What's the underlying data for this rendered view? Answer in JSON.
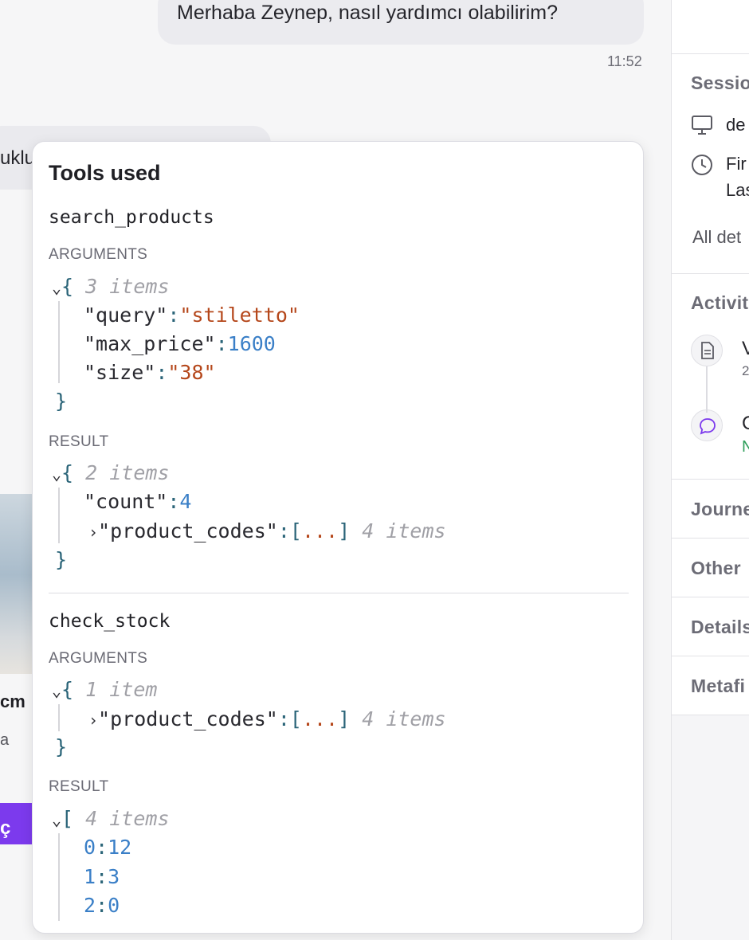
{
  "chat": {
    "outgoing_message": "Merhaba Zeynep, nasıl yardımcı olabilirim?",
    "outgoing_time": "11:52",
    "incoming_fragment": "uklu",
    "card_title_fragment": "cm",
    "card_sub_fragment": "a",
    "card_button_fragment": "ç"
  },
  "right_panel": {
    "session_title": "Sessio",
    "device_text": "de",
    "first_seen": "Fir",
    "last_seen": "Las",
    "all_details": "All det",
    "activity_title": "Activit",
    "activity_1_title": "V",
    "activity_1_sub": "2",
    "activity_2_title": "C",
    "activity_2_sub": "N",
    "journey_title": "Journe",
    "other_title": "Other",
    "details_title": "Details",
    "metafields_title": "Metafi",
    "icons": [
      "monitor-icon",
      "clock-icon",
      "document-icon",
      "chat-bubble-icon"
    ],
    "colors": {
      "activity_status": "#2e9e5b",
      "chat_icon": "#7c3aed"
    }
  },
  "tools_popover": {
    "title": "Tools used",
    "args_label": "ARGUMENTS",
    "result_label": "RESULT",
    "tool1": {
      "name": "search_products",
      "args_summary": "3 items",
      "args": [
        {
          "key": "\"query\"",
          "value": "\"stiletto\""
        },
        {
          "key": "\"max_price\"",
          "value": "1600"
        },
        {
          "key": "\"size\"",
          "value": "\"38\""
        }
      ],
      "result_summary": "2 items",
      "result": [
        {
          "key": "\"count\"",
          "value": "4"
        },
        {
          "key": "\"product_codes\"",
          "value": "[...]",
          "meta": "4 items"
        }
      ]
    },
    "tool2": {
      "name": "check_stock",
      "args_summary": "1 item",
      "args": [
        {
          "key": "\"product_codes\"",
          "value": "[...]",
          "meta": "4 items"
        }
      ],
      "result_summary": "4 items",
      "result": [
        {
          "key": "0",
          "value": "12"
        },
        {
          "key": "1",
          "value": "3"
        },
        {
          "key": "2",
          "value": "0"
        }
      ]
    }
  }
}
